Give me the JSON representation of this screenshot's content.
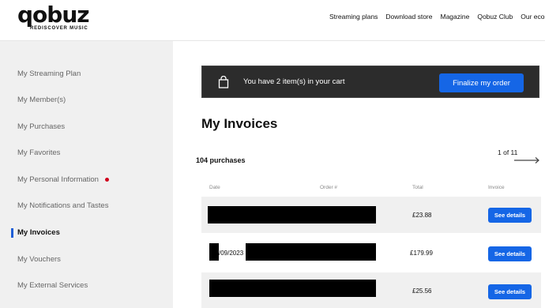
{
  "header": {
    "logo_text": "qobuz",
    "logo_tagline": "REDISCOVER MUSIC",
    "nav": [
      "Streaming plans",
      "Download store",
      "Magazine",
      "Qobuz Club",
      "Our ecosy"
    ]
  },
  "sidebar": {
    "items": [
      {
        "label": "My Streaming Plan"
      },
      {
        "label": "My Member(s)"
      },
      {
        "label": "My Purchases"
      },
      {
        "label": "My Favorites"
      },
      {
        "label": "My Personal Information"
      },
      {
        "label": "My Notifications and Tastes"
      },
      {
        "label": "My Invoices"
      },
      {
        "label": "My Vouchers"
      },
      {
        "label": "My External Services"
      }
    ],
    "active": "My Invoices"
  },
  "cart": {
    "text": "You have 2 item(s) in your cart",
    "button": "Finalize my order"
  },
  "page": {
    "title": "My Invoices",
    "count_text": "104 purchases",
    "pager": "1 of 11"
  },
  "table": {
    "headers": {
      "date": "Date",
      "order": "Order #",
      "total": "Total",
      "invoice": "Invoice"
    },
    "rows": [
      {
        "date": "",
        "order": "",
        "total": "£23.88",
        "action": "See details"
      },
      {
        "date": "/09/2023",
        "order": "",
        "total": "£179.99",
        "action": "See details"
      },
      {
        "date": "",
        "order": "",
        "total": "£25.56",
        "action": "See details"
      }
    ]
  },
  "colors": {
    "accent": "#1566e6",
    "notification_dot": "#d0021b",
    "cart_bar": "#2c2c2c"
  }
}
